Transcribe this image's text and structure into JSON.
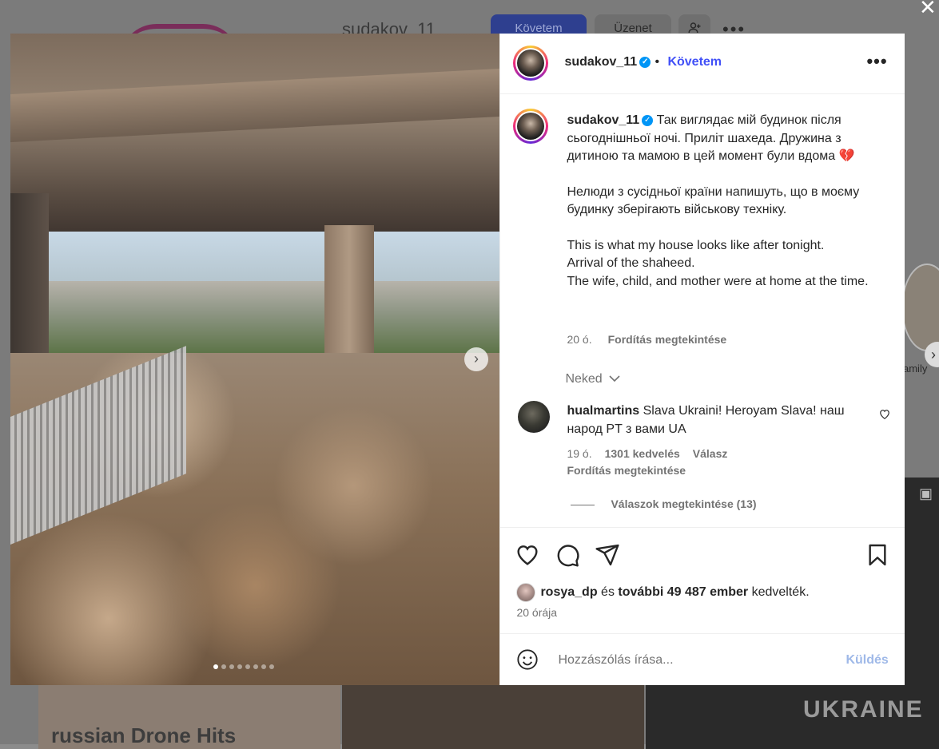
{
  "background": {
    "username": "sudakov_11",
    "follow_label": "Követem",
    "message_label": "Üzenet",
    "highlight_label": "amily",
    "tile_text": "russian Drone Hits",
    "tile_shirt": "UKRAINE"
  },
  "post": {
    "header": {
      "username": "sudakov_11",
      "separator": "•",
      "follow_label": "Követem",
      "more_label": "•••"
    },
    "caption": {
      "username": "sudakov_11",
      "para1": "Так виглядає мій будинок після сьогоднішньої ночі. Приліт шахеда. Дружина з дитиною та мамою в цей момент були вдома 💔",
      "para2": "Нелюди з сусідньої країни напишуть, що в моєму будинку зберігають військову техніку.",
      "para3_l1": "This is what my house looks like after tonight.",
      "para3_l2": "Arrival of the shaheed.",
      "para3_l3": "The wife, child, and mother were at home at the time.",
      "time": "20 ó.",
      "translate": "Fordítás megtekintése"
    },
    "comment_sort": "Neked",
    "comment": {
      "username": "hualmartins",
      "text": "Slava Ukraini! Heroyam Slava! наш народ PT з вами UA",
      "time": "19 ó.",
      "likes": "1301 kedvelés",
      "reply": "Válasz",
      "translate": "Fordítás megtekintése",
      "view_replies": "Válaszok megtekintése (13)"
    },
    "likes": {
      "user": "rosya_dp",
      "and": "és",
      "others": "további 49 487 ember",
      "suffix": "kedvelték."
    },
    "posted": "20 órája",
    "comment_input": {
      "placeholder": "Hozzászólás írása...",
      "value": ""
    },
    "send_label": "Küldés",
    "media": {
      "next_arrow": "›",
      "slide_count": 8,
      "active_slide": 1
    }
  },
  "colors": {
    "accent": "#4150f7",
    "verified": "#0095f6",
    "send_disabled": "#9fb9e8",
    "text_primary": "#262626",
    "text_secondary": "#737373"
  },
  "icons": [
    "heart-icon",
    "comment-icon",
    "share-icon",
    "bookmark-icon",
    "emoji-icon",
    "verified-icon",
    "chevron-right-icon",
    "chevron-down-icon",
    "more-icon",
    "close-icon"
  ]
}
